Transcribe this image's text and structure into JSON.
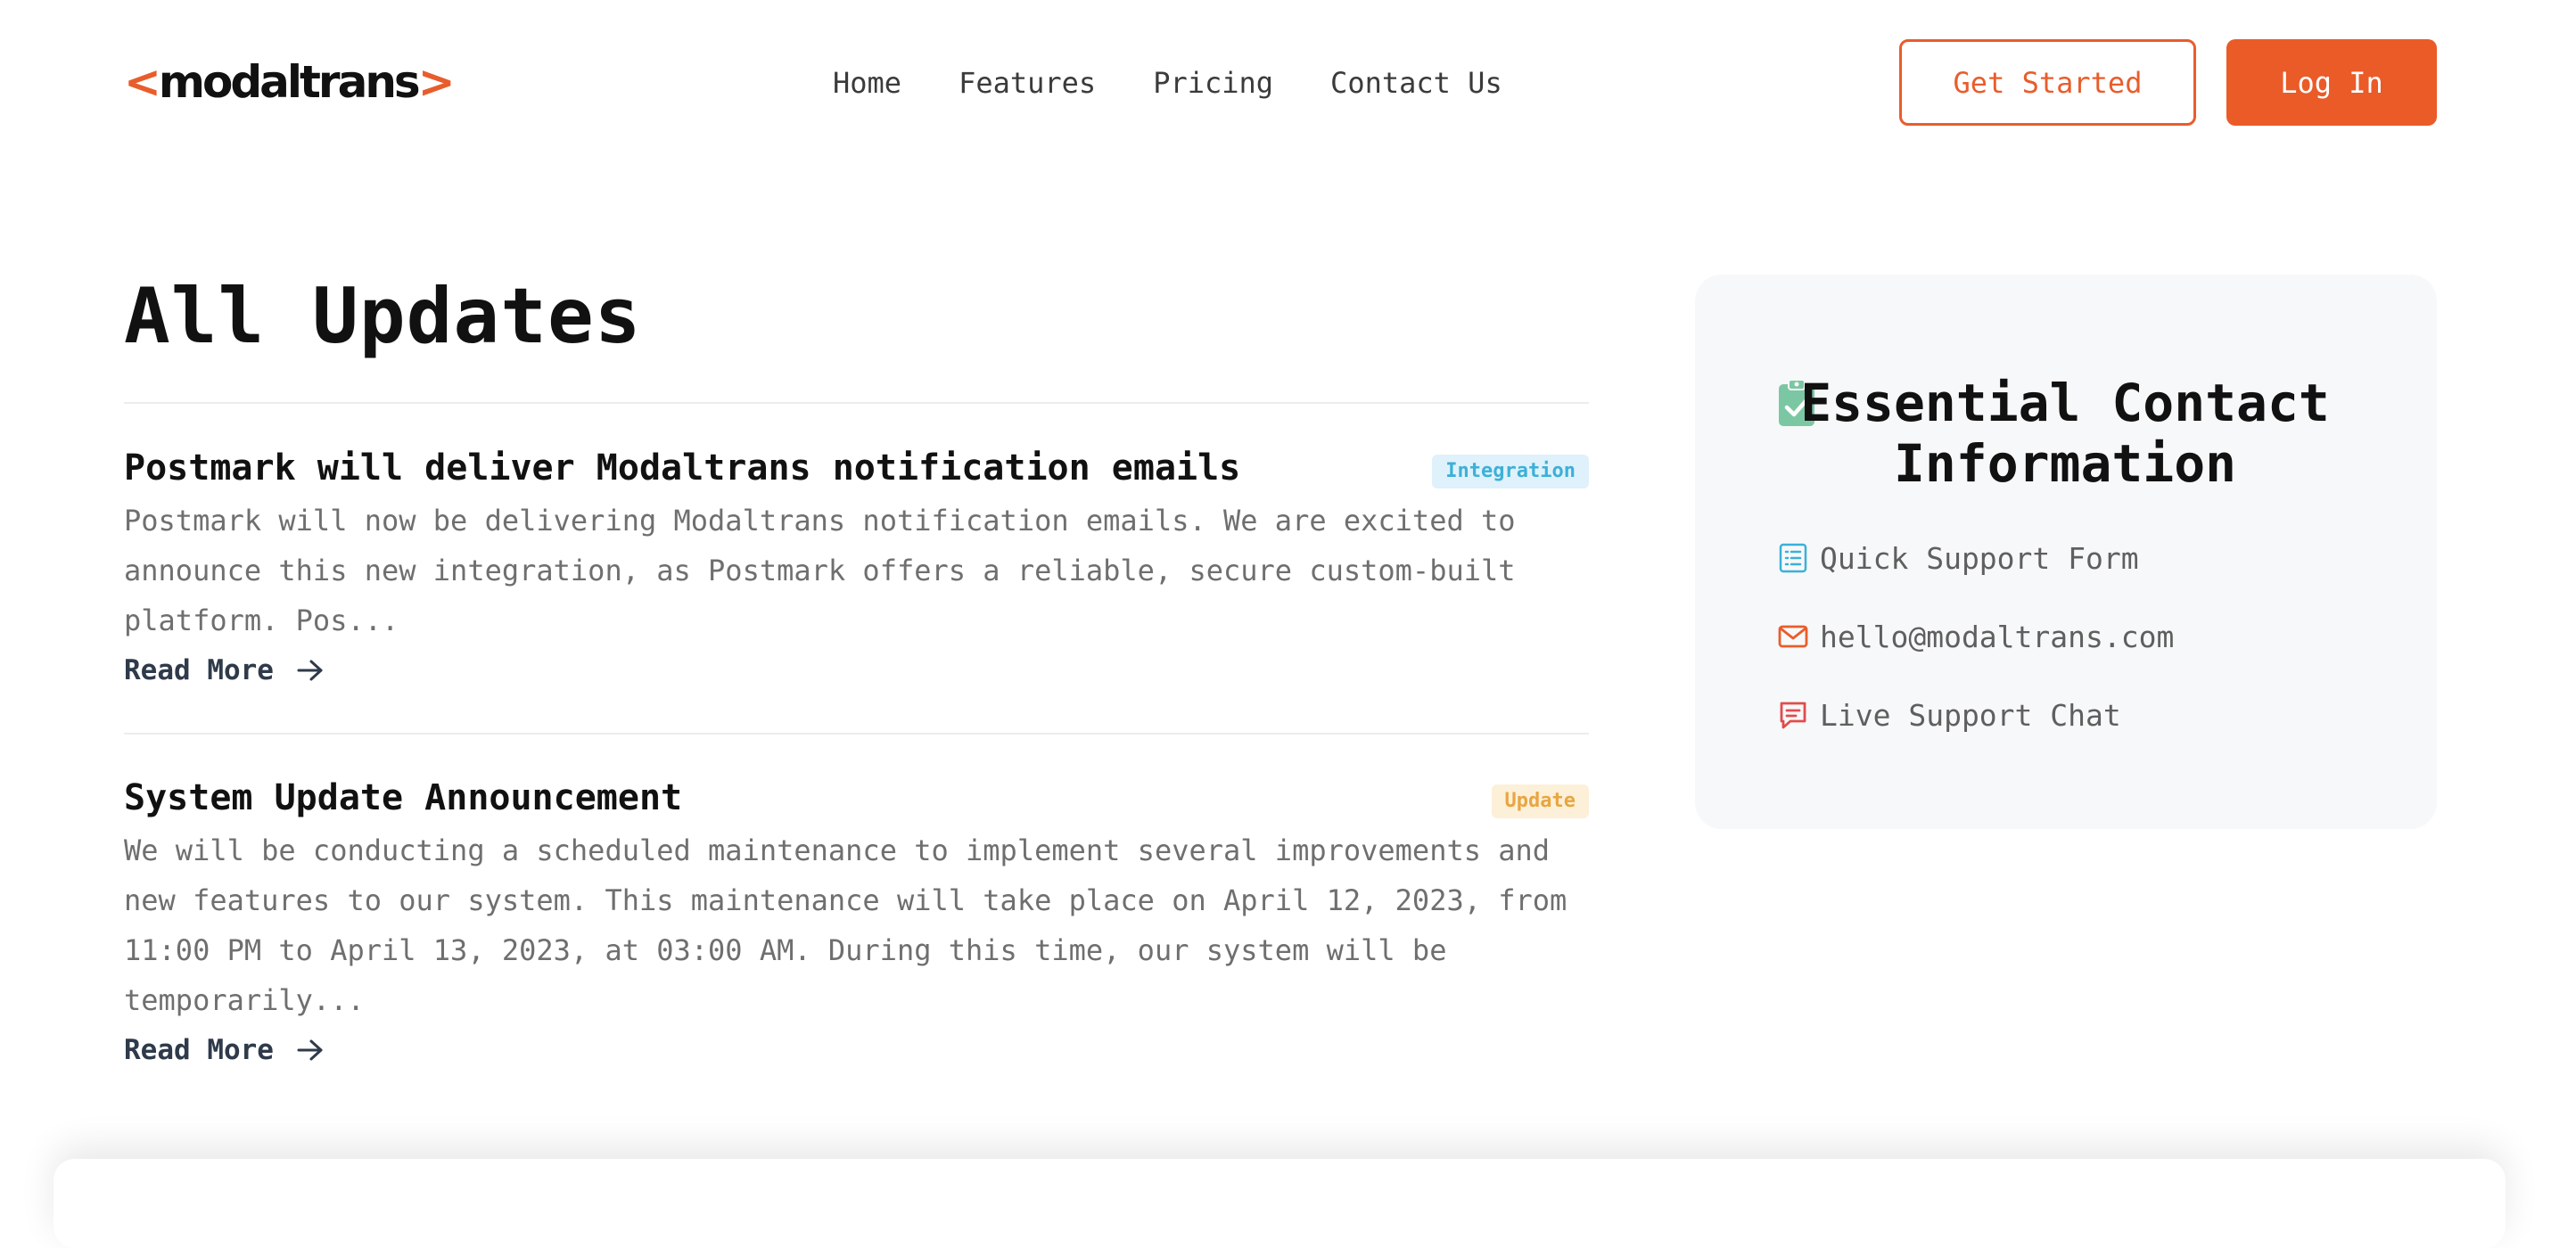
{
  "header": {
    "logo_text": "modaltrans",
    "logo_left": "<",
    "logo_right": ">",
    "nav": [
      {
        "label": "Home"
      },
      {
        "label": "Features"
      },
      {
        "label": "Pricing"
      },
      {
        "label": "Contact Us"
      }
    ],
    "get_started_label": "Get Started",
    "login_label": "Log In"
  },
  "main": {
    "title": "All Updates",
    "posts": [
      {
        "title": "Postmark will deliver Modaltrans notification emails",
        "tag": "Integration",
        "excerpt": "Postmark will now be delivering Modaltrans notification emails. We are excited to announce this new integration, as Postmark offers a reliable, secure custom-built platform. Pos...",
        "read_more": "Read More"
      },
      {
        "title": "System Update Announcement",
        "tag": "Update",
        "excerpt": "We will be conducting a scheduled maintenance to implement several improvements and new features to our system. This maintenance will take place on April 12, 2023, from 11:00 PM to April 13, 2023, at 03:00 AM. During this time, our system will be temporarily...",
        "read_more": "Read More"
      }
    ]
  },
  "sidebar": {
    "title": "Essential Contact Information",
    "title_icon": "clipboard-check-icon",
    "items": [
      {
        "label": "Quick Support Form",
        "icon": "form-list-icon"
      },
      {
        "label": "hello@modaltrans.com",
        "icon": "mail-icon"
      },
      {
        "label": "Live Support Chat",
        "icon": "chat-icon"
      }
    ]
  },
  "colors": {
    "brand": "#ea5b28",
    "tag_integration": "#3cb0d8",
    "tag_update": "#e9a542",
    "clipboard": "#7cc7a3"
  }
}
